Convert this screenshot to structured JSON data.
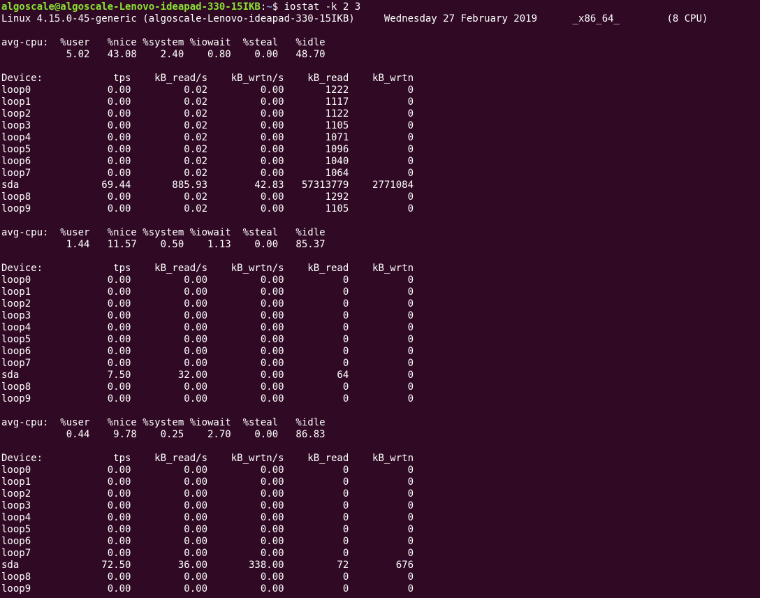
{
  "prompt": {
    "user_host": "algoscale@algoscale-Lenovo-ideapad-330-15IKB",
    "separator": ":",
    "cwd": "~",
    "symbol": "$ ",
    "command": "iostat -k 2 3"
  },
  "system_line": "Linux 4.15.0-45-generic (algoscale-Lenovo-ideapad-330-15IKB)     Wednesday 27 February 2019      _x86_64_        (8 CPU)",
  "lines": [
    "",
    "avg-cpu:  %user   %nice %system %iowait  %steal   %idle",
    "           5.02   43.08    2.40    0.80    0.00   48.70",
    "",
    "Device:            tps    kB_read/s    kB_wrtn/s    kB_read    kB_wrtn",
    "loop0             0.00         0.02         0.00       1222          0",
    "loop1             0.00         0.02         0.00       1117          0",
    "loop2             0.00         0.02         0.00       1122          0",
    "loop3             0.00         0.02         0.00       1105          0",
    "loop4             0.00         0.02         0.00       1071          0",
    "loop5             0.00         0.02         0.00       1096          0",
    "loop6             0.00         0.02         0.00       1040          0",
    "loop7             0.00         0.02         0.00       1064          0",
    "sda              69.44       885.93        42.83   57313779    2771084",
    "loop8             0.00         0.02         0.00       1292          0",
    "loop9             0.00         0.02         0.00       1105          0",
    "",
    "avg-cpu:  %user   %nice %system %iowait  %steal   %idle",
    "           1.44   11.57    0.50    1.13    0.00   85.37",
    "",
    "Device:            tps    kB_read/s    kB_wrtn/s    kB_read    kB_wrtn",
    "loop0             0.00         0.00         0.00          0          0",
    "loop1             0.00         0.00         0.00          0          0",
    "loop2             0.00         0.00         0.00          0          0",
    "loop3             0.00         0.00         0.00          0          0",
    "loop4             0.00         0.00         0.00          0          0",
    "loop5             0.00         0.00         0.00          0          0",
    "loop6             0.00         0.00         0.00          0          0",
    "loop7             0.00         0.00         0.00          0          0",
    "sda               7.50        32.00         0.00         64          0",
    "loop8             0.00         0.00         0.00          0          0",
    "loop9             0.00         0.00         0.00          0          0",
    "",
    "avg-cpu:  %user   %nice %system %iowait  %steal   %idle",
    "           0.44    9.78    0.25    2.70    0.00   86.83",
    "",
    "Device:            tps    kB_read/s    kB_wrtn/s    kB_read    kB_wrtn",
    "loop0             0.00         0.00         0.00          0          0",
    "loop1             0.00         0.00         0.00          0          0",
    "loop2             0.00         0.00         0.00          0          0",
    "loop3             0.00         0.00         0.00          0          0",
    "loop4             0.00         0.00         0.00          0          0",
    "loop5             0.00         0.00         0.00          0          0",
    "loop6             0.00         0.00         0.00          0          0",
    "loop7             0.00         0.00         0.00          0          0",
    "sda              72.50        36.00       338.00         72        676",
    "loop8             0.00         0.00         0.00          0          0",
    "loop9             0.00         0.00         0.00          0          0"
  ],
  "colors": {
    "background": "#300a24",
    "foreground": "#ffffff",
    "prompt_user": "#8ae234",
    "prompt_path": "#729fcf"
  }
}
